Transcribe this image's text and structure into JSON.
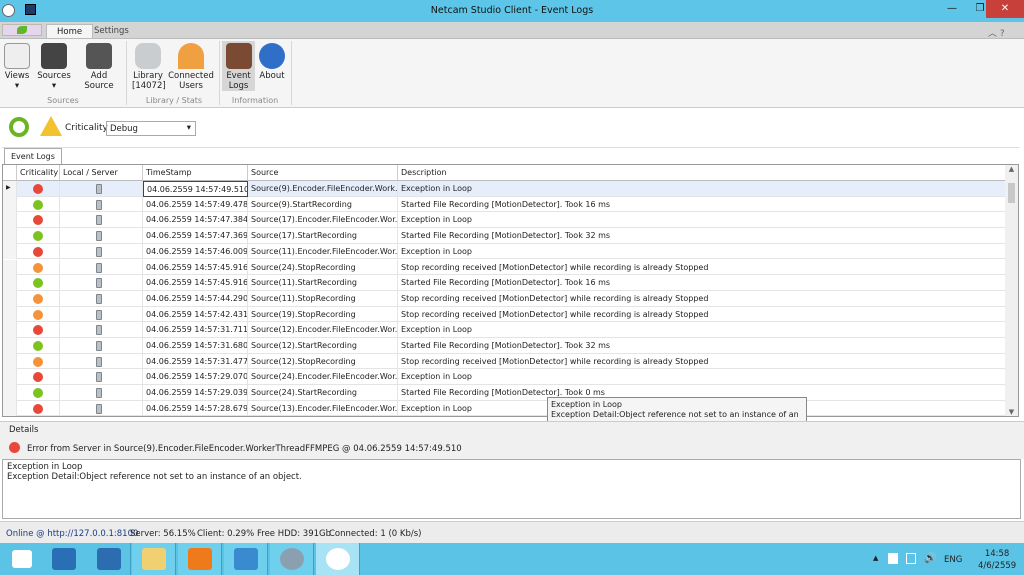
{
  "window": {
    "title": "Netcam Studio Client - Event Logs"
  },
  "ribbon_tabs": [
    {
      "label": "Home"
    },
    {
      "label": "Settings"
    }
  ],
  "ribbon": {
    "buttons": [
      {
        "label": "Views"
      },
      {
        "label": "Sources"
      },
      {
        "label": "Add Source"
      },
      {
        "label": "Library\n[14072]"
      },
      {
        "label": "Connected\nUsers"
      },
      {
        "label": "Event\nLogs"
      },
      {
        "label": "About"
      }
    ],
    "groups": [
      {
        "label": "Sources"
      },
      {
        "label": "Library / Stats"
      },
      {
        "label": "Information"
      }
    ]
  },
  "toolbar": {
    "criticality_label": "Criticality",
    "criticality_value": "Debug"
  },
  "panel_tab": "Event Logs",
  "grid": {
    "columns": [
      "Criticality",
      "Local / Server",
      "TimeStamp",
      "Source",
      "Description"
    ],
    "colors": {
      "error": "#e8483a",
      "info": "#7cc31f",
      "warning": "#f5933a"
    },
    "rows": [
      {
        "level": "error",
        "ts": "04.06.2559 14:57:49.510",
        "src": "Source(9).Encoder.FileEncoder.Work...",
        "desc": "Exception in Loop"
      },
      {
        "level": "info",
        "ts": "04.06.2559 14:57:49.478",
        "src": "Source(9).StartRecording",
        "desc": "Started File Recording [MotionDetector]. Took 16 ms"
      },
      {
        "level": "error",
        "ts": "04.06.2559 14:57:47.384",
        "src": "Source(17).Encoder.FileEncoder.Wor...",
        "desc": "Exception in Loop"
      },
      {
        "level": "info",
        "ts": "04.06.2559 14:57:47.369",
        "src": "Source(17).StartRecording",
        "desc": "Started File Recording [MotionDetector]. Took 32 ms"
      },
      {
        "level": "error",
        "ts": "04.06.2559 14:57:46.009",
        "src": "Source(11).Encoder.FileEncoder.Wor...",
        "desc": "Exception in Loop"
      },
      {
        "level": "warning",
        "ts": "04.06.2559 14:57:45.916",
        "src": "Source(24).StopRecording",
        "desc": "Stop recording received [MotionDetector] while recording is already Stopped"
      },
      {
        "level": "info",
        "ts": "04.06.2559 14:57:45.916",
        "src": "Source(11).StartRecording",
        "desc": "Started File Recording [MotionDetector]. Took 16 ms"
      },
      {
        "level": "warning",
        "ts": "04.06.2559 14:57:44.290",
        "src": "Source(11).StopRecording",
        "desc": "Stop recording received [MotionDetector] while recording is already Stopped"
      },
      {
        "level": "warning",
        "ts": "04.06.2559 14:57:42.431",
        "src": "Source(19).StopRecording",
        "desc": "Stop recording received [MotionDetector] while recording is already Stopped"
      },
      {
        "level": "error",
        "ts": "04.06.2559 14:57:31.711",
        "src": "Source(12).Encoder.FileEncoder.Wor...",
        "desc": "Exception in Loop"
      },
      {
        "level": "info",
        "ts": "04.06.2559 14:57:31.680",
        "src": "Source(12).StartRecording",
        "desc": "Started File Recording [MotionDetector]. Took 32 ms"
      },
      {
        "level": "warning",
        "ts": "04.06.2559 14:57:31.477",
        "src": "Source(12).StopRecording",
        "desc": "Stop recording received [MotionDetector] while recording is already Stopped"
      },
      {
        "level": "error",
        "ts": "04.06.2559 14:57:29.070",
        "src": "Source(24).Encoder.FileEncoder.Wor...",
        "desc": "Exception in Loop"
      },
      {
        "level": "info",
        "ts": "04.06.2559 14:57:29.039",
        "src": "Source(24).StartRecording",
        "desc": "Started File Recording [MotionDetector]. Took 0 ms"
      },
      {
        "level": "error",
        "ts": "04.06.2559 14:57:28.679",
        "src": "Source(13).Encoder.FileEncoder.Wor...",
        "desc": "Exception in Loop"
      }
    ]
  },
  "tooltip": {
    "line1": "Exception in Loop",
    "line2": "Exception Detail:Object reference not set to an instance of an object."
  },
  "details": {
    "header": "Details",
    "summary": "Error from Server in Source(9).Encoder.FileEncoder.WorkerThreadFFMPEG @ 04.06.2559 14:57:49.510",
    "line1": "Exception in Loop",
    "line2": "Exception Detail:Object reference not set to an instance of an object."
  },
  "status": {
    "online": "Online @ http://127.0.0.1:8100",
    "server": "Server: 56.15%",
    "client": "Client: 0.29%",
    "hdd": "Free HDD: 391Gb",
    "connected": "Connected: 1 (0 Kb/s)"
  },
  "taskbar": {
    "lang": "ENG",
    "time": "14:58",
    "date": "4/6/2559"
  }
}
